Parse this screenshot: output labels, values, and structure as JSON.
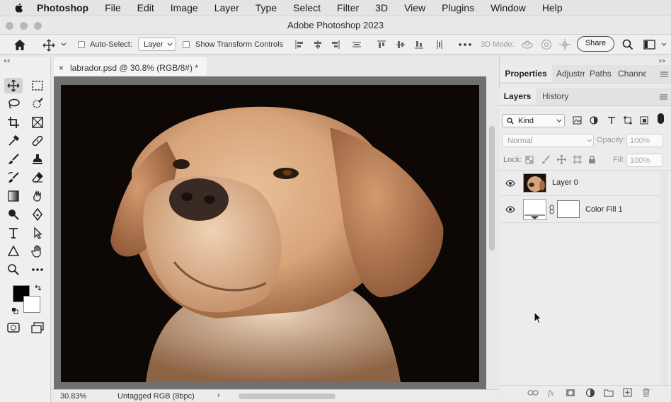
{
  "menubar": {
    "app_name": "Photoshop",
    "items": [
      "File",
      "Edit",
      "Image",
      "Layer",
      "Type",
      "Select",
      "Filter",
      "3D",
      "View",
      "Plugins",
      "Window",
      "Help"
    ]
  },
  "window": {
    "title": "Adobe Photoshop 2023"
  },
  "options_bar": {
    "auto_select_label": "Auto-Select:",
    "auto_select_value": "Layer",
    "show_transform_label": "Show Transform Controls",
    "mode_3d_label": "3D Mode:",
    "share_label": "Share"
  },
  "document": {
    "tab_label": "labrador.psd @ 30.8% (RGB/8#) *",
    "close_glyph": "×",
    "zoom_value": "30.83%",
    "color_profile": "Untagged RGB (8bpc)",
    "status_arrow": "›"
  },
  "panel_tabs_top": [
    "Properties",
    "Adjustm",
    "Paths",
    "Channe"
  ],
  "panel_tabs_layers": [
    "Layers",
    "History"
  ],
  "layers_panel": {
    "filter_kind": "Kind",
    "blend_mode": "Normal",
    "opacity_label": "Opacity:",
    "opacity_value": "100%",
    "lock_label": "Lock:",
    "fill_label": "Fill:",
    "fill_value": "100%",
    "layers": [
      {
        "name": "Layer 0"
      },
      {
        "name": "Color Fill 1"
      }
    ]
  },
  "colors": {
    "accent_selection": "#d2d2d2",
    "foreground_swatch": "#000000",
    "background_swatch": "#ffffff"
  }
}
